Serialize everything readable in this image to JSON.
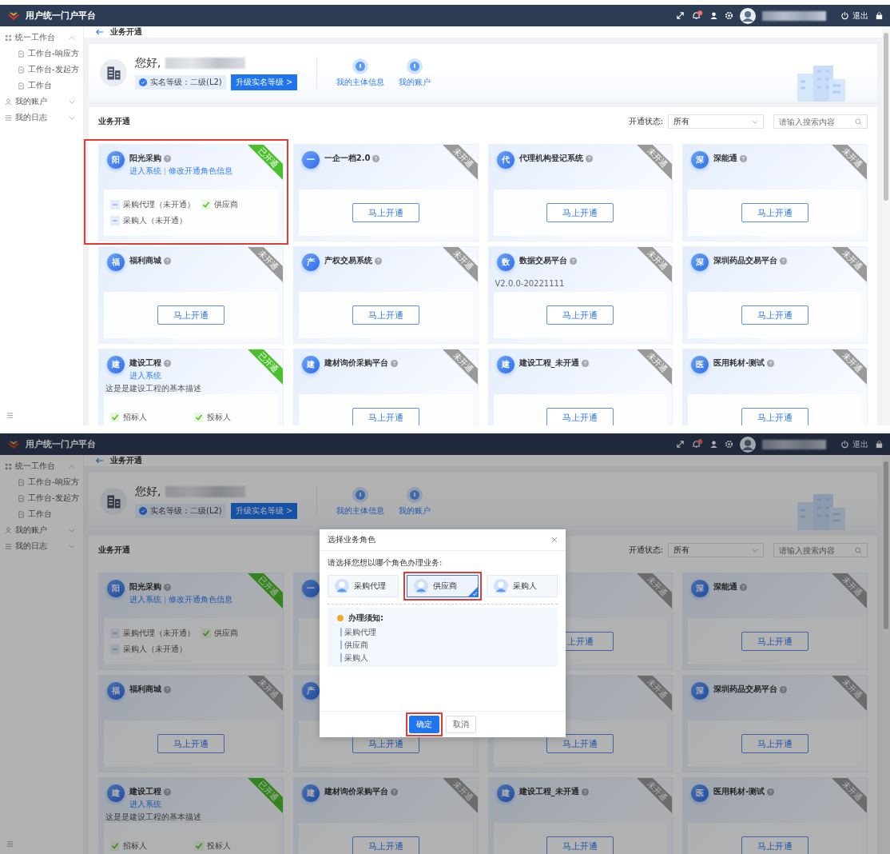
{
  "screens": [
    {
      "header": {
        "title": "用户统一门户平台",
        "logout": "退出"
      },
      "sidebar": {
        "items": [
          {
            "label": "统一工作台",
            "expanded": true,
            "children": [
              {
                "label": "工作台-响应方"
              },
              {
                "label": "工作台-发起方"
              },
              {
                "label": "工作台"
              }
            ]
          },
          {
            "label": "我的账户",
            "expanded": false
          },
          {
            "label": "我的日志",
            "expanded": false
          }
        ]
      },
      "breadcrumb": "业务开通",
      "profile": {
        "greeting": "您好,",
        "verification": "实名等级：二级(L2)",
        "upgrade_button": "升级实名等级 >",
        "links": [
          "我的主体信息",
          "我的账户"
        ]
      },
      "section": {
        "title": "业务开通",
        "filter_label": "开通状态:",
        "filter_value": "所有",
        "search": {
          "placeholder": "请输入搜索内容"
        }
      },
      "cards": [
        {
          "badge": "阳",
          "title": "阳光采购",
          "links": [
            "进入系统",
            "修改开通角色信息"
          ],
          "ribbon": "已开通",
          "opened": true,
          "highlighted": true,
          "roles": [
            {
              "label": "采购代理（未开通）",
              "checked": false
            },
            {
              "label": "供应商",
              "checked": true
            },
            {
              "label": "采购人（未开通）",
              "checked": false
            }
          ]
        },
        {
          "badge": "一",
          "title": "一企一档2.0",
          "ribbon": "未开通",
          "opened": false,
          "highlighted": false,
          "button": "马上开通"
        },
        {
          "badge": "代",
          "title": "代理机构登记系统",
          "ribbon": "未开通",
          "opened": false,
          "highlighted": false,
          "button": "马上开通"
        },
        {
          "badge": "深",
          "title": "深能通",
          "ribbon": "未开通",
          "opened": false,
          "highlighted": false,
          "button": "马上开通"
        },
        {
          "badge": "福",
          "title": "福利商城",
          "ribbon": "未开通",
          "opened": false,
          "highlighted": false,
          "button": "马上开通"
        },
        {
          "badge": "产",
          "title": "产权交易系统",
          "ribbon": "未开通",
          "opened": false,
          "highlighted": false,
          "button": "马上开通"
        },
        {
          "badge": "数",
          "title": "数据交易平台",
          "version": "V2.0.0-20221111",
          "ribbon": "未开通",
          "opened": false,
          "highlighted": false,
          "button": "马上开通"
        },
        {
          "badge": "深",
          "title": "深圳药品交易平台",
          "ribbon": "未开通",
          "opened": false,
          "highlighted": false,
          "button": "马上开通"
        },
        {
          "badge": "建",
          "title": "建设工程",
          "links": [
            "进入系统"
          ],
          "description": "这是是建设工程的基本描述",
          "ribbon": "已开通",
          "opened": true,
          "highlighted": false,
          "roles": [
            {
              "label": "招标人",
              "checked": true
            },
            {
              "label": "投标人",
              "checked": true
            }
          ]
        },
        {
          "badge": "建",
          "title": "建材询价采购平台",
          "ribbon": "未开通",
          "opened": false,
          "highlighted": false,
          "button": "马上开通"
        },
        {
          "badge": "建",
          "title": "建设工程_未开通",
          "ribbon": "未开通",
          "opened": false,
          "highlighted": false,
          "button": "马上开通"
        },
        {
          "badge": "医",
          "title": "医用耗材-测试",
          "ribbon": "未开通",
          "opened": false,
          "highlighted": false,
          "button": "马上开通"
        }
      ]
    },
    {
      "header": {
        "title": "用户统一门户平台",
        "logout": "退出"
      },
      "sidebar": {
        "items": [
          {
            "label": "统一工作台",
            "expanded": true,
            "children": [
              {
                "label": "工作台-响应方"
              },
              {
                "label": "工作台-发起方"
              },
              {
                "label": "工作台"
              }
            ]
          },
          {
            "label": "我的账户",
            "expanded": false
          },
          {
            "label": "我的日志",
            "expanded": false
          }
        ]
      },
      "breadcrumb": "业务开通",
      "profile": {
        "greeting": "您好,",
        "verification": "实名等级：二级(L2)",
        "upgrade_button": "升级实名等级 >",
        "links": [
          "我的主体信息",
          "我的账户"
        ]
      },
      "section": {
        "title": "业务开通",
        "filter_label": "开通状态:",
        "filter_value": "所有",
        "search": {
          "placeholder": "请输入搜索内容"
        }
      },
      "cards": [
        {
          "badge": "阳",
          "title": "阳光采购",
          "links": [
            "进入系统",
            "修改开通角色信息"
          ],
          "ribbon": "已开通",
          "opened": true,
          "highlighted": false,
          "roles": [
            {
              "label": "采购代理（未开通）",
              "checked": false
            },
            {
              "label": "供应商",
              "checked": true
            },
            {
              "label": "采购人（未开通）",
              "checked": false
            }
          ]
        },
        {
          "badge": "一",
          "highlighted": false
        },
        {
          "ribbon": "未开通",
          "opened": false,
          "highlighted": false,
          "button": "上开通"
        },
        {
          "badge": "深",
          "title": "深能通",
          "ribbon": "未开通",
          "opened": false,
          "highlighted": false,
          "button": "马上开通"
        },
        {
          "badge": "福",
          "title": "福利商城",
          "ribbon": "未开通",
          "opened": false,
          "highlighted": false,
          "button": "马上开通"
        },
        {
          "badge": "产",
          "highlighted": false,
          "button": "马上开通"
        },
        {
          "ribbon": "未开通",
          "opened": false,
          "highlighted": false,
          "button": "马上开通"
        },
        {
          "badge": "深",
          "title": "深圳药品交易平台",
          "ribbon": "未开通",
          "opened": false,
          "highlighted": false,
          "button": "马上开通"
        },
        {
          "badge": "建",
          "title": "建设工程",
          "links": [
            "进入系统"
          ],
          "description": "这是是建设工程的基本描述",
          "ribbon": "已开通",
          "opened": true,
          "highlighted": false,
          "roles": [
            {
              "label": "招标人",
              "checked": true
            },
            {
              "label": "投标人",
              "checked": true
            }
          ]
        },
        {
          "badge": "建",
          "title": "建材询价采购平台",
          "ribbon": "未开通",
          "opened": false,
          "highlighted": false,
          "button": "马上开通"
        },
        {
          "badge": "建",
          "title": "建设工程_未开通",
          "ribbon": "未开通",
          "opened": false,
          "highlighted": false,
          "button": "马上开通"
        },
        {
          "badge": "医",
          "title": "医用耗材-测试",
          "ribbon": "未开通",
          "opened": false,
          "highlighted": false,
          "button": "马上开通"
        }
      ],
      "dialog": {
        "title": "选择业务角色",
        "prompt": "请选择您想以哪个角色办理业务:",
        "roles": [
          {
            "label": "采购代理",
            "selected": false,
            "highlighted": false
          },
          {
            "label": "供应商",
            "selected": true,
            "highlighted": true
          },
          {
            "label": "采购人",
            "selected": false,
            "highlighted": false
          }
        ],
        "notice_title": "办理须知:",
        "notice_items": [
          "采购代理",
          "供应商",
          "采购人"
        ],
        "buttons": [
          {
            "label": "确定",
            "kind": "primary",
            "highlighted": true
          },
          {
            "label": "取消",
            "kind": "default",
            "highlighted": false
          }
        ]
      }
    }
  ]
}
